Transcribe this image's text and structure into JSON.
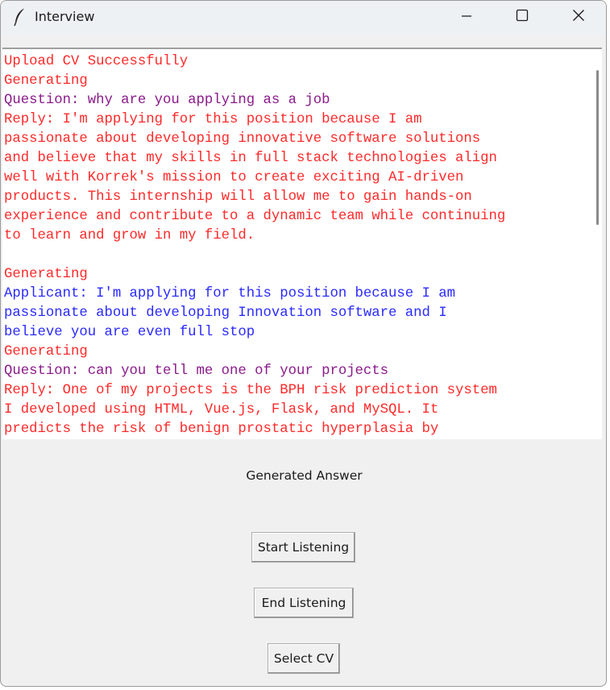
{
  "window": {
    "title": "Interview",
    "app_icon": "feather-icon",
    "controls": {
      "minimize_icon": "minimize-icon",
      "maximize_icon": "maximize-icon",
      "close_icon": "close-icon"
    }
  },
  "transcript": {
    "lines": [
      {
        "text": "Upload CV Successfully",
        "color": "#ff2a2a"
      },
      {
        "text": "Generating",
        "color": "#ff2a2a"
      },
      {
        "text": "Question: why are you applying as a job",
        "color": "#8a1a8a"
      },
      {
        "text": "Reply: I'm applying for this position because I am",
        "color": "#ff2a2a"
      },
      {
        "text": "passionate about developing innovative software solutions",
        "color": "#ff2a2a"
      },
      {
        "text": "and believe that my skills in full stack technologies align",
        "color": "#ff2a2a"
      },
      {
        "text": "well with Korrek's mission to create exciting AI-driven",
        "color": "#ff2a2a"
      },
      {
        "text": "products. This internship will allow me to gain hands-on",
        "color": "#ff2a2a"
      },
      {
        "text": "experience and contribute to a dynamic team while continuing",
        "color": "#ff2a2a"
      },
      {
        "text": "to learn and grow in my field.",
        "color": "#ff2a2a"
      },
      {
        "text": "",
        "color": "#ff2a2a"
      },
      {
        "text": "Generating",
        "color": "#ff2a2a"
      },
      {
        "text": "Applicant: I'm applying for this position because I am",
        "color": "#2a2aff"
      },
      {
        "text": "passionate about developing Innovation software and I",
        "color": "#2a2aff"
      },
      {
        "text": "believe you are even full stop",
        "color": "#2a2aff"
      },
      {
        "text": "Generating",
        "color": "#ff2a2a"
      },
      {
        "text": "Question: can you tell me one of your projects",
        "color": "#8a1a8a"
      },
      {
        "text": "Reply: One of my projects is the BPH risk prediction system",
        "color": "#ff2a2a"
      },
      {
        "text": "I developed using HTML, Vue.js, Flask, and MySQL. It",
        "color": "#ff2a2a"
      },
      {
        "text": "predicts the risk of benign prostatic hyperplasia by",
        "color": "#ff2a2a"
      }
    ]
  },
  "status": {
    "label": "Generated Answer"
  },
  "buttons": {
    "start_listening": "Start Listening",
    "end_listening": "End Listening",
    "select_cv": "Select CV"
  },
  "colors": {
    "reply": "#ff2a2a",
    "question": "#8a1a8a",
    "applicant": "#2a2aff",
    "window_bg": "#f0f0f0"
  }
}
